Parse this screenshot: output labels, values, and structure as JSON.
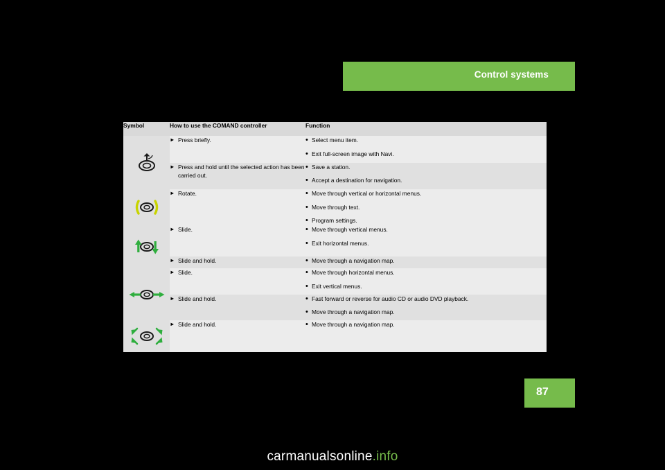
{
  "header": {
    "title": "Control systems"
  },
  "page": {
    "number": "87"
  },
  "table": {
    "headers": {
      "symbol": "Symbol",
      "how": "How to use the COMAND controller",
      "function": "Function"
    },
    "rows": [
      {
        "symbol_icon": "controller-press-icon",
        "groups": [
          {
            "how": "Press briefly.",
            "functions": [
              "Select menu item.",
              "Exit full-screen image with Navi."
            ]
          },
          {
            "how": "Press and hold until the selected ac­tion has been carried out.",
            "functions": [
              "Save a station.",
              "Accept a destination for navigation."
            ]
          }
        ]
      },
      {
        "symbol_icon": "controller-rotate-icon",
        "groups": [
          {
            "how": "Rotate.",
            "functions": [
              "Move through vertical or horizontal menus.",
              "Move through text.",
              "Program settings."
            ]
          }
        ]
      },
      {
        "symbol_icon": "controller-slide-vertical-icon",
        "groups": [
          {
            "how": "Slide.",
            "functions": [
              "Move through vertical menus.",
              "Exit horizontal menus."
            ]
          },
          {
            "how": "Slide and hold.",
            "functions": [
              "Move through a navigation map."
            ]
          }
        ]
      },
      {
        "symbol_icon": "controller-slide-horizontal-icon",
        "groups": [
          {
            "how": "Slide.",
            "functions": [
              "Move through horizontal menus.",
              "Exit vertical menus."
            ]
          },
          {
            "how": "Slide and hold.",
            "functions": [
              "Fast forward or reverse for audio CD or audio DVD playback.",
              "Move through a navigation map."
            ]
          }
        ]
      },
      {
        "symbol_icon": "controller-slide-diagonal-icon",
        "groups": [
          {
            "how": "Slide and hold.",
            "functions": [
              "Move through a navigation map."
            ]
          }
        ]
      }
    ]
  },
  "watermark": {
    "text": "carmanualsonline",
    "suffix": ".info"
  },
  "colors": {
    "accent_green": "#76bb4b",
    "background": "#000000",
    "table_header": "#d9d9d9",
    "row_light": "#ececec",
    "row_dark": "#e0e0e0"
  }
}
